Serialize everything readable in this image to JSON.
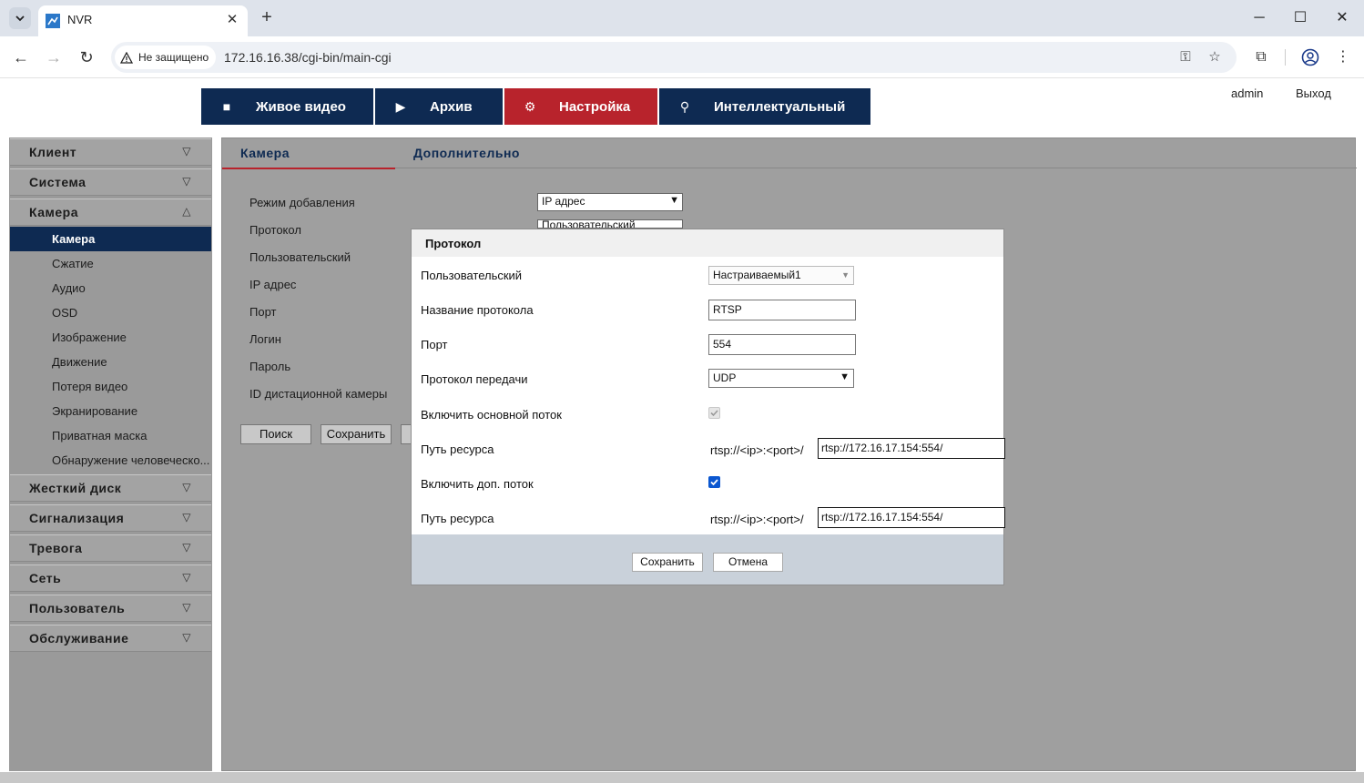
{
  "browser": {
    "tab_title": "NVR",
    "tab_close": "✕",
    "new_tab": "+",
    "security_label": "Не защищено",
    "url": "172.16.16.38/cgi-bin/main-cgi",
    "window_controls": {
      "minimize": "─",
      "maximize": "☐",
      "close": "✕"
    }
  },
  "header": {
    "nav": [
      {
        "label": "Живое видео",
        "icon": "camera-icon"
      },
      {
        "label": "Архив",
        "icon": "playback-icon"
      },
      {
        "label": "Настройка",
        "icon": "gear-icon",
        "active": true
      },
      {
        "label": "Интеллектуальный",
        "icon": "search-icon"
      }
    ],
    "user": "admin",
    "logout": "Выход"
  },
  "sidebar": {
    "sections": [
      {
        "label": "Клиент"
      },
      {
        "label": "Система"
      },
      {
        "label": "Камера",
        "expanded": true
      },
      {
        "label": "Жесткий диск"
      },
      {
        "label": "Сигнализация"
      },
      {
        "label": "Тревога"
      },
      {
        "label": "Сеть"
      },
      {
        "label": "Пользователь"
      },
      {
        "label": "Обслуживание"
      }
    ],
    "camera_items": [
      "Камера",
      "Сжатие",
      "Аудио",
      "OSD",
      "Изображение",
      "Движение",
      "Потеря видео",
      "Экранирование",
      "Приватная маска",
      "Обнаружение человеческо..."
    ],
    "selected_item": "Камера"
  },
  "content": {
    "tabs": [
      "Камера",
      "Дополнительно"
    ],
    "form": {
      "labels": [
        "Режим добавления",
        "Протокол",
        "Пользовательский",
        "IP адрес",
        "Порт",
        "Логин",
        "Пароль",
        "ID дистационной камеры"
      ],
      "mode_value": "IP адрес",
      "protocol_value": "Пользовательский"
    },
    "buttons": {
      "search": "Поиск",
      "save": "Сохранить"
    }
  },
  "dialog": {
    "title": "Протокол",
    "custom_label": "Пользовательский",
    "custom_value": "Настраиваемый1",
    "name_label": "Название протокола",
    "name_value": "RTSP",
    "port_label": "Порт",
    "port_value": "554",
    "transport_label": "Протокол передачи",
    "transport_value": "UDP",
    "main_stream_label": "Включить основной поток",
    "main_stream_checked": true,
    "main_stream_disabled": true,
    "path_label": "Путь ресурса",
    "path_prefix": "rtsp://<ip>:<port>/",
    "main_path_value": "rtsp://172.16.17.154:554/",
    "sub_stream_label": "Включить доп. поток",
    "sub_stream_checked": true,
    "sub_path_value": "rtsp://172.16.17.154:554/",
    "save": "Сохранить",
    "cancel": "Отмена"
  },
  "colors": {
    "nav_dark": "#0e2a52",
    "accent_red": "#b8232c",
    "overlay_gray": "#9f9f9f",
    "checkbox_blue": "#0b57d0"
  }
}
